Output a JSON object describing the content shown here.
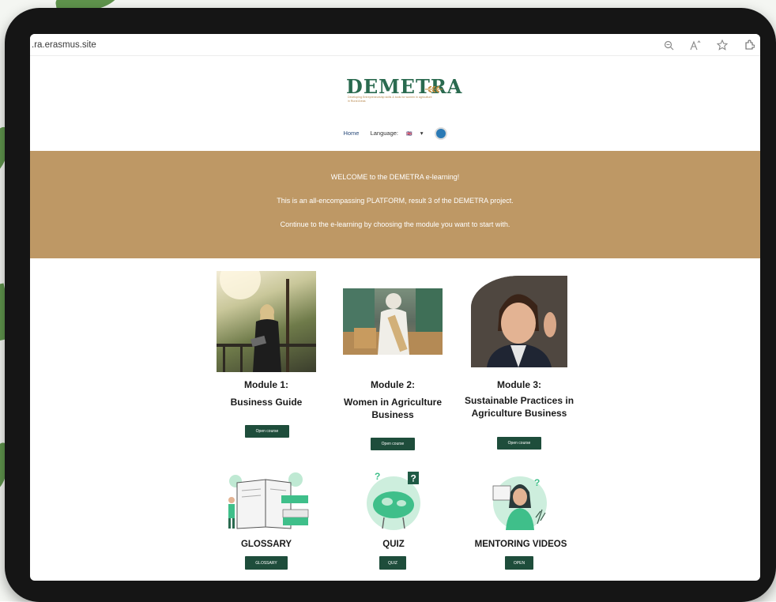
{
  "browser": {
    "url": ".ra.erasmus.site",
    "icons": [
      "zoom-icon",
      "read-aloud-icon",
      "favorite-star-icon",
      "extensions-icon"
    ]
  },
  "site": {
    "logo": "DEMETRA",
    "tagline": "Developing Entrepreneurship skills & tools for women in agriculture in Rural Areas",
    "nav": {
      "home": "Home",
      "language": "Language:",
      "flag": "🇬🇧",
      "caret": "▾"
    }
  },
  "banner": {
    "line1": "WELCOME to the DEMETRA e-learning!",
    "line2": "This is an all-encompassing PLATFORM, result 3 of the DEMETRA project.",
    "line3": "Continue to the e-learning by choosing the module you want to start with."
  },
  "modules": [
    {
      "heading": "Module 1:",
      "title": "Business Guide",
      "button": "Open course"
    },
    {
      "heading": "Module 2:",
      "title": "Women in Agriculture Business",
      "button": "Open course"
    },
    {
      "heading": "Module 3:",
      "title": "Sustainable Practices in Agriculture Business",
      "button": "Open course"
    }
  ],
  "resources": [
    {
      "label": "GLOSSARY",
      "button": "GLOSSARY"
    },
    {
      "label": "QUIZ",
      "button": "QUIZ"
    },
    {
      "label": "MENTORING VIDEOS",
      "button": "OPEN"
    }
  ],
  "colors": {
    "banner": "#be9865",
    "button": "#1e4d3b",
    "logo": "#2a6a4f",
    "illustration": "#3fbf8a"
  }
}
